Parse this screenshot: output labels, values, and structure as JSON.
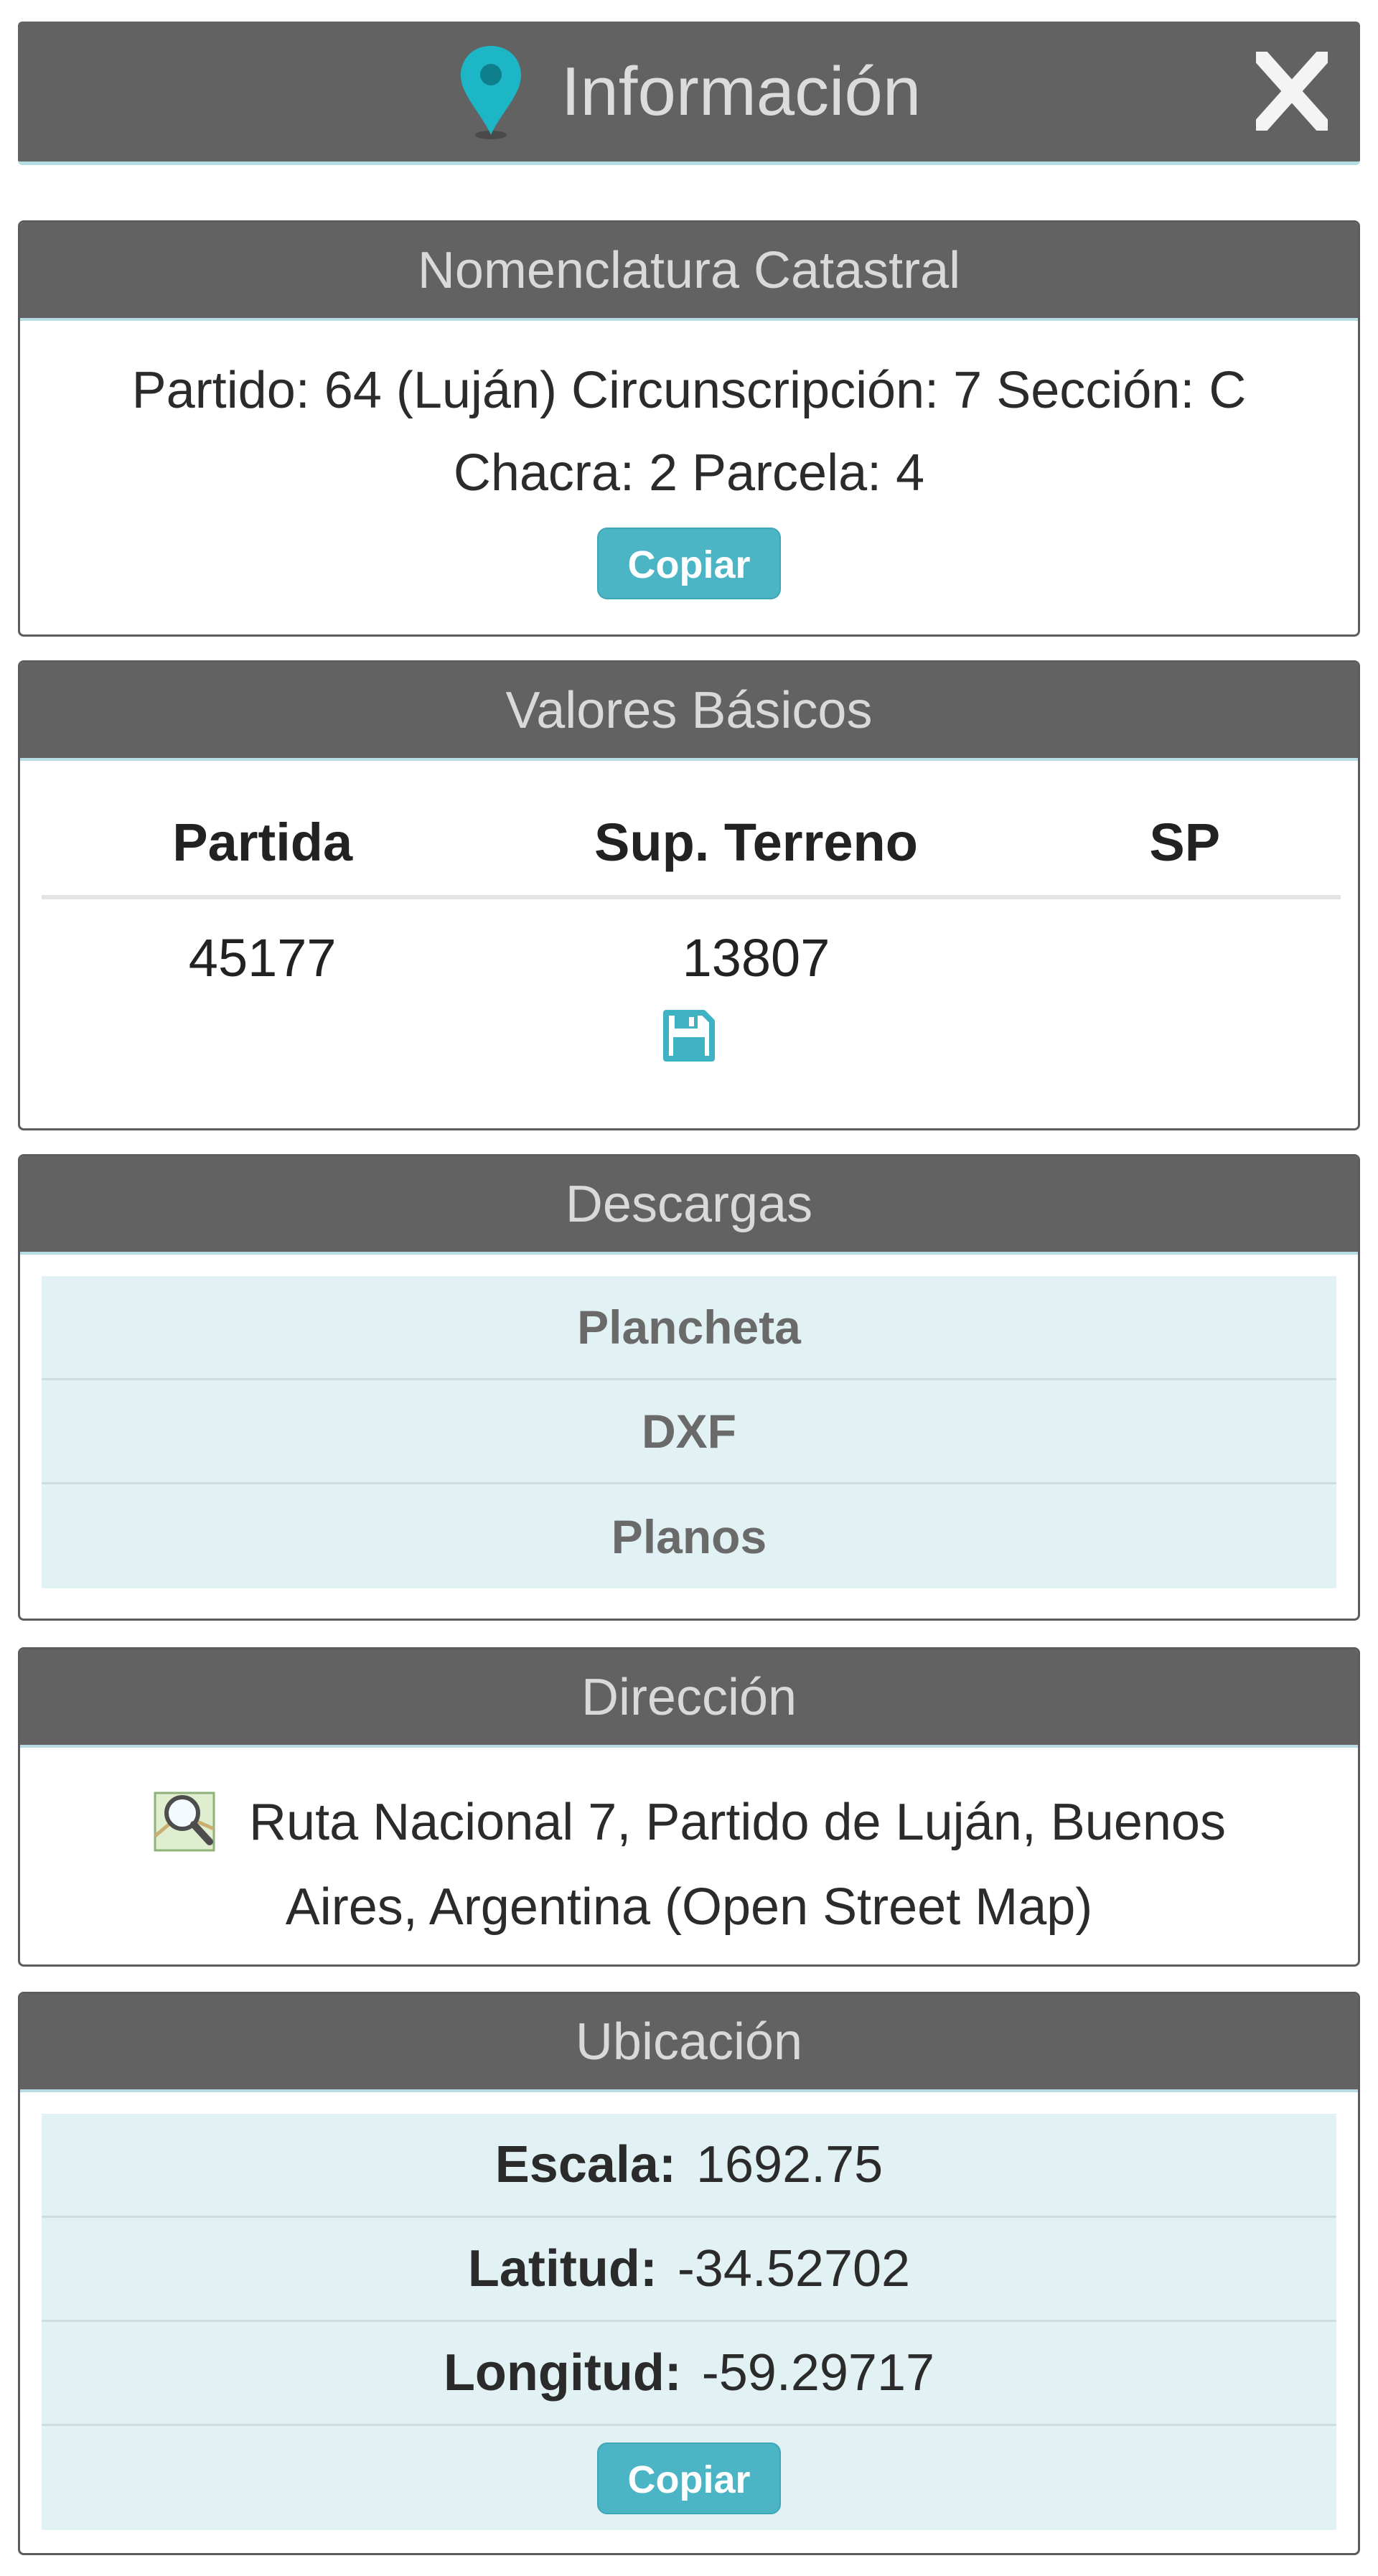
{
  "header": {
    "title": "Información",
    "close_label": "X"
  },
  "nomenclatura": {
    "heading": "Nomenclatura Catastral",
    "line1": "Partido: 64 (Luján) Circunscripción: 7 Sección: C",
    "line2": "Chacra: 2 Parcela: 4",
    "copy_label": "Copiar"
  },
  "valores": {
    "heading": "Valores Básicos",
    "columns": [
      "Partida",
      "Sup. Terreno",
      "SP"
    ],
    "row": [
      "45177",
      "13807",
      ""
    ]
  },
  "descargas": {
    "heading": "Descargas",
    "items": [
      "Plancheta",
      "DXF",
      "Planos"
    ]
  },
  "direccion": {
    "heading": "Dirección",
    "line1": "Ruta Nacional 7, Partido de Luján, Buenos",
    "line2": "Aires, Argentina (Open Street Map)"
  },
  "ubicacion": {
    "heading": "Ubicación",
    "escala_label": "Escala:",
    "escala_value": "1692.75",
    "latitud_label": "Latitud:",
    "latitud_value": "-34.52702",
    "longitud_label": "Longitud:",
    "longitud_value": "-59.29717",
    "copy_label": "Copiar"
  },
  "colors": {
    "header_bg": "#626262",
    "accent": "#4bb5c5",
    "row_bg": "#e1f1f4"
  },
  "icons": [
    "map-pin-icon",
    "close-icon",
    "save-icon",
    "map-search-icon"
  ]
}
